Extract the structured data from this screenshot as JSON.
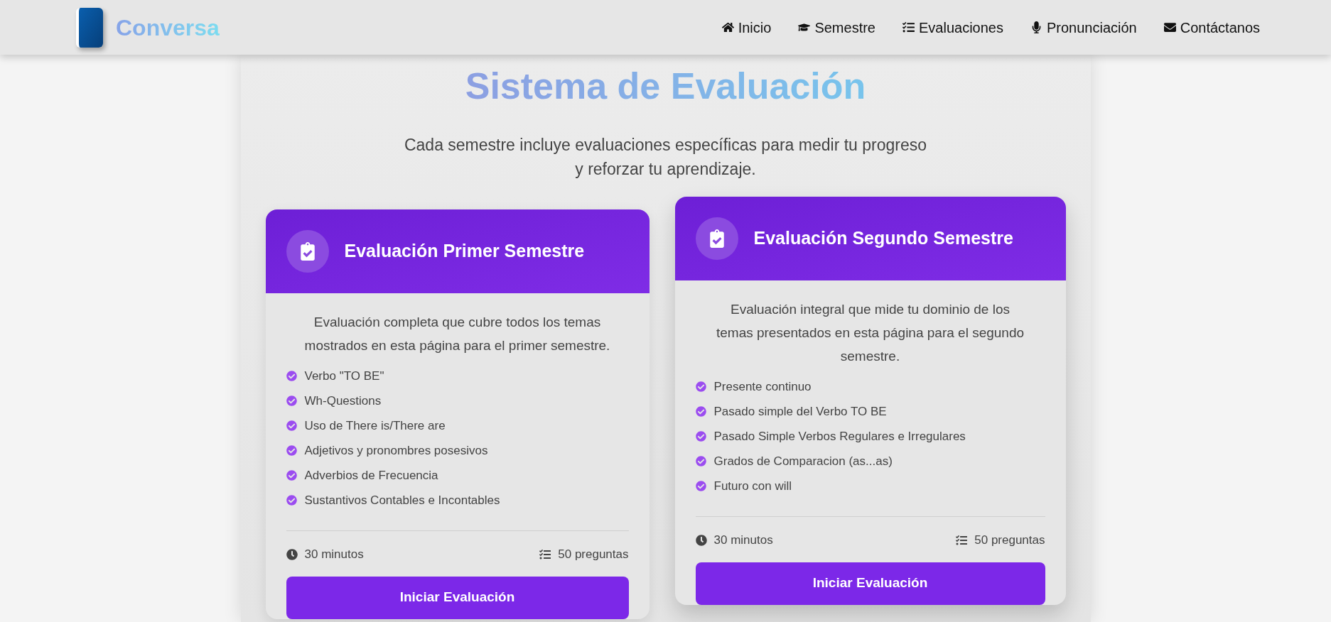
{
  "brand": {
    "name": "Conversa"
  },
  "nav": [
    {
      "kind": "home",
      "label": "Inicio"
    },
    {
      "kind": "cap",
      "label": "Semestre"
    },
    {
      "kind": "list",
      "label": "Evaluaciones"
    },
    {
      "kind": "mic",
      "label": "Pronunciación"
    },
    {
      "kind": "mail",
      "label": "Contáctanos"
    }
  ],
  "section": {
    "title": "Sistema de Evaluación",
    "subtitle": [
      "Cada semestre incluye evaluaciones específicas para medir tu progreso",
      "y reforzar tu aprendizaje."
    ]
  },
  "cards": [
    {
      "title": "Evaluación Primer Semestre",
      "raised": false,
      "description": "Evaluación completa que cubre todos los temas mostrados en esta página para el primer semestre.",
      "topics": [
        "Verbo \"TO BE\"",
        "Wh-Questions",
        "Uso de There is/There are",
        "Adjetivos y pronombres posesivos",
        "Adverbios de Frecuencia",
        "Sustantivos Contables e Incontables"
      ],
      "duration": "30 minutos",
      "questions": "50 preguntas",
      "button": "Iniciar Evaluación"
    },
    {
      "title": "Evaluación Segundo Semestre",
      "raised": true,
      "description": "Evaluación integral que mide tu dominio de los temas presentados en esta página para el segundo semestre.",
      "topics": [
        "Presente continuo",
        "Pasado simple del Verbo TO BE",
        "Pasado Simple Verbos Regulares e Irregulares",
        "Grados de Comparacion (as...as)",
        "Futuro con will"
      ],
      "duration": "30 minutos",
      "questions": "50 preguntas",
      "button": "Iniciar Evaluación"
    }
  ]
}
